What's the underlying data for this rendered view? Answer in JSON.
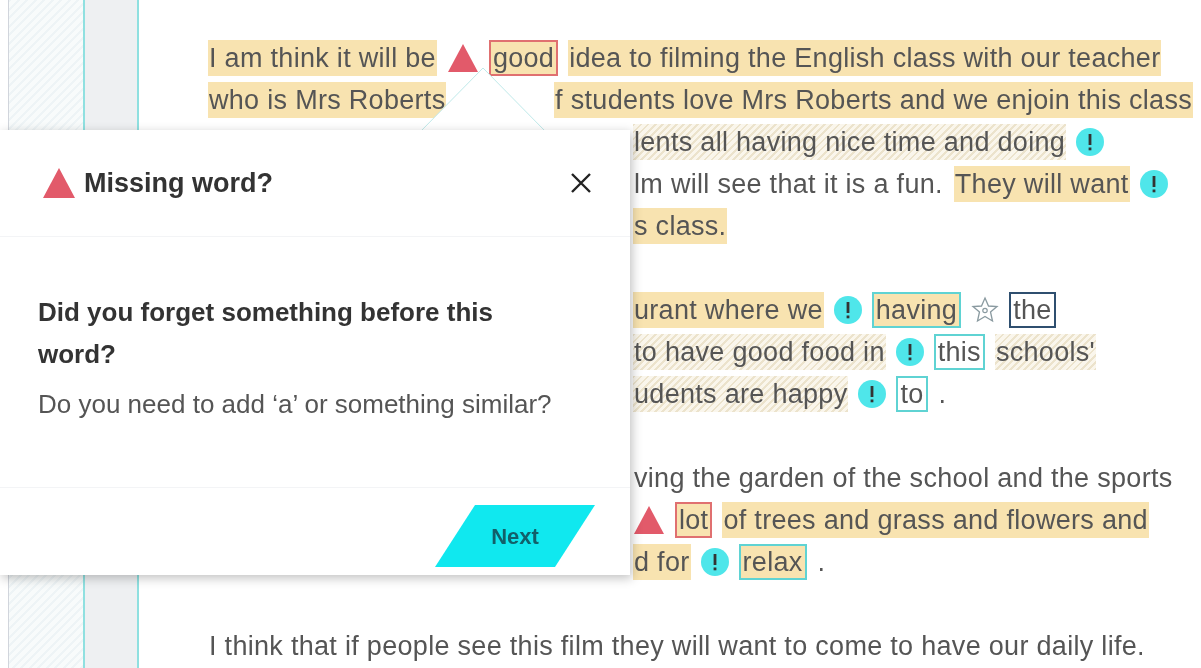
{
  "essay": {
    "paragraphs": [
      {
        "lines": [
          {
            "under_popup": false,
            "segments": [
              {
                "kind": "text",
                "text": "I am think it will be",
                "highlighted": true,
                "hatched": false
              },
              {
                "kind": "missing"
              },
              {
                "kind": "word",
                "text": "good",
                "highlighted": true,
                "hatched": false,
                "color": "#e07070"
              },
              {
                "kind": "text",
                "text": "idea to filming the English class with our teacher",
                "highlighted": true,
                "hatched": false
              }
            ]
          },
          {
            "under_popup": false,
            "split": true,
            "segments": [
              {
                "kind": "text",
                "text": "who is Mrs Roberts",
                "highlighted": true,
                "hatched": false
              },
              {
                "kind": "text",
                "text": "f students love Mrs Roberts and we enjoin this class",
                "highlighted": true,
                "hatched": false
              }
            ]
          },
          {
            "under_popup": true,
            "segments": [
              {
                "kind": "text",
                "text": "lents all having nice time and doing",
                "highlighted": false,
                "hatched": true
              },
              {
                "kind": "flag"
              }
            ]
          },
          {
            "under_popup": true,
            "segments": [
              {
                "kind": "text",
                "text": "lm will see that it is a fun.",
                "highlighted": false,
                "hatched": false
              },
              {
                "kind": "text",
                "text": "They will want",
                "highlighted": true,
                "hatched": false
              },
              {
                "kind": "flag"
              }
            ]
          },
          {
            "under_popup": true,
            "segments": [
              {
                "kind": "text",
                "text": "s class.",
                "highlighted": true,
                "hatched": false
              }
            ]
          }
        ]
      },
      {
        "lines": [
          {
            "under_popup": true,
            "segments": [
              {
                "kind": "text",
                "text": "urant where we",
                "highlighted": true,
                "hatched": false
              },
              {
                "kind": "flag"
              },
              {
                "kind": "word",
                "text": "having",
                "highlighted": true,
                "hatched": false,
                "color": "#5fd3d3"
              },
              {
                "kind": "star"
              },
              {
                "kind": "word",
                "text": "the",
                "highlighted": false,
                "hatched": false,
                "color": "#2f4f6f"
              }
            ]
          },
          {
            "under_popup": true,
            "segments": [
              {
                "kind": "text",
                "text": "to have good food in",
                "highlighted": false,
                "hatched": true
              },
              {
                "kind": "flag"
              },
              {
                "kind": "word",
                "text": "this",
                "highlighted": false,
                "hatched": false,
                "color": "#5fd3d3"
              },
              {
                "kind": "text",
                "text": "schools'",
                "highlighted": false,
                "hatched": true
              }
            ]
          },
          {
            "under_popup": true,
            "segments": [
              {
                "kind": "text",
                "text": "udents are happy",
                "highlighted": false,
                "hatched": true
              },
              {
                "kind": "flag"
              },
              {
                "kind": "word",
                "text": "to",
                "highlighted": false,
                "hatched": false,
                "color": "#5fd3d3"
              },
              {
                "kind": "text",
                "text": ".",
                "highlighted": false,
                "hatched": false
              }
            ]
          }
        ]
      },
      {
        "lines": [
          {
            "under_popup": true,
            "segments": [
              {
                "kind": "text",
                "text": "ving the garden of the school and the sports",
                "highlighted": false,
                "hatched": false
              }
            ]
          },
          {
            "under_popup": true,
            "segments": [
              {
                "kind": "missing"
              },
              {
                "kind": "word",
                "text": "lot",
                "highlighted": true,
                "hatched": false,
                "color": "#e07070"
              },
              {
                "kind": "text",
                "text": "of trees and grass and flowers and",
                "highlighted": true,
                "hatched": false
              }
            ]
          },
          {
            "under_popup": true,
            "segments": [
              {
                "kind": "text",
                "text": "d for",
                "highlighted": true,
                "hatched": false
              },
              {
                "kind": "flag"
              },
              {
                "kind": "word",
                "text": "relax",
                "highlighted": true,
                "hatched": false,
                "color": "#5fd3d3"
              },
              {
                "kind": "text",
                "text": ".",
                "highlighted": false,
                "hatched": false
              }
            ]
          }
        ]
      },
      {
        "lines": [
          {
            "under_popup": false,
            "segments": [
              {
                "kind": "text",
                "text": "I think that if people see this film they will want to come to have our daily life.",
                "highlighted": false,
                "hatched": false
              }
            ]
          }
        ]
      }
    ]
  },
  "popup": {
    "title": "Missing word?",
    "heading": "Did you forget something before this word?",
    "message": "Do you need to add ‘a’ or something similar?",
    "next_button": "Next"
  }
}
